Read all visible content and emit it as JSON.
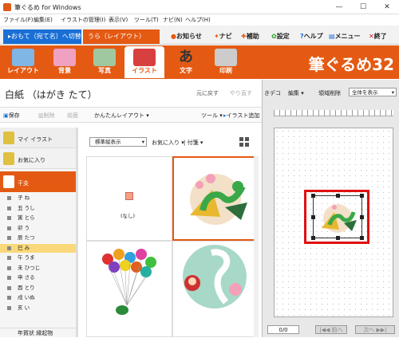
{
  "window": {
    "title": "筆ぐるめ for Windows",
    "min": "—",
    "max": "☐",
    "close": "✕"
  },
  "menu": [
    "ファイル(F)",
    "編集(E)",
    "イラストの管理(I)",
    "表示(V)",
    "ツール(T)",
    "ナビ(N)",
    "ヘルプ(H)"
  ],
  "modes": {
    "front": "▸おもて（宛て名）へ切替",
    "back": "うら（レイアウト）"
  },
  "top_actions": {
    "news": "お知らせ",
    "navi": "ナビ",
    "assist": "補助",
    "settings": "設定",
    "help": "ヘルプ",
    "menu": "メニュー",
    "quit": "終了"
  },
  "tools": [
    {
      "label": "レイアウト",
      "color": "#7fb6e6"
    },
    {
      "label": "背景",
      "color": "#f0a0c0"
    },
    {
      "label": "写真",
      "color": "#a0c8a0"
    },
    {
      "label": "イラスト",
      "color": "#d84040"
    },
    {
      "label": "文字",
      "color": "#333333"
    },
    {
      "label": "印刷",
      "color": "#cccccc"
    }
  ],
  "brand": "筆ぐるめ32",
  "paper": {
    "name": "白紙 （はがき たて）",
    "undo": "元に戻す",
    "redo": "やり直す"
  },
  "filebar": {
    "save": "保存",
    "delete": "削除",
    "front": "前面",
    "easy_layout": "かんたんレイアウト",
    "tools": "ツール",
    "add_illust": "イラスト追加"
  },
  "categories": {
    "my_illust": "マイ イラスト",
    "favorites": "お気に入り",
    "eto": "干支",
    "nenga": "年賀状 縁起物"
  },
  "zodiac": [
    "子 ね",
    "丑 うし",
    "寅 とら",
    "卯 う",
    "辰 たつ",
    "巳 み",
    "午 うま",
    "未 ひつじ",
    "申 さる",
    "酉 とり",
    "戌 いぬ",
    "亥 い"
  ],
  "selected_zodiac": "巳 み",
  "gallery": {
    "view": "標準縦表示",
    "fav": "お気に入り",
    "stamp": "付箋",
    "none_label": "(なし)"
  },
  "right": {
    "deco": "きデコ",
    "edit": "編集",
    "area_delete": "領域削除",
    "show_all": "全体を表示",
    "page": "0/0",
    "prev": "|◀◀ 前へ",
    "next": "次へ ▶▶|"
  },
  "colors": {
    "orange": "#e45a13",
    "blue": "#1a6fd6",
    "red": "#e01010"
  }
}
